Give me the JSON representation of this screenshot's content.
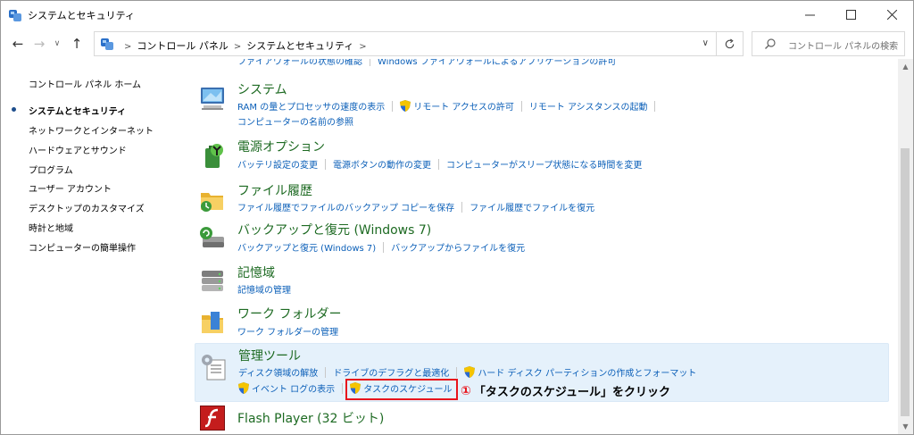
{
  "window": {
    "title": "システムとセキュリティ"
  },
  "address": {
    "crumbs": [
      "コントロール パネル",
      "システムとセキュリティ"
    ],
    "search_placeholder": "コントロール パネルの検索"
  },
  "leftnav": {
    "home": "コントロール パネル ホーム",
    "items": [
      {
        "label": "システムとセキュリティ",
        "selected": true
      },
      {
        "label": "ネットワークとインターネット"
      },
      {
        "label": "ハードウェアとサウンド"
      },
      {
        "label": "プログラム"
      },
      {
        "label": "ユーザー アカウント"
      },
      {
        "label": "デスクトップのカスタマイズ"
      },
      {
        "label": "時計と地域"
      },
      {
        "label": "コンピューターの簡単操作"
      }
    ]
  },
  "categories": {
    "firewall": {
      "links": [
        "ファイアウォールの状態の確認",
        "Windows ファイアウォールによるアプリケーションの許可"
      ]
    },
    "system": {
      "title": "システム",
      "links_row1": [
        "RAM の量とプロセッサの速度の表示",
        "リモート アクセスの許可",
        "リモート アシスタンスの起動"
      ],
      "links_row2": [
        "コンピューターの名前の参照"
      ]
    },
    "power": {
      "title": "電源オプション",
      "links": [
        "バッテリ設定の変更",
        "電源ボタンの動作の変更",
        "コンピューターがスリープ状態になる時間を変更"
      ]
    },
    "history": {
      "title": "ファイル履歴",
      "links": [
        "ファイル履歴でファイルのバックアップ コピーを保存",
        "ファイル履歴でファイルを復元"
      ]
    },
    "backup": {
      "title": "バックアップと復元 (Windows 7)",
      "links": [
        "バックアップと復元 (Windows 7)",
        "バックアップからファイルを復元"
      ]
    },
    "storage": {
      "title": "記憶域",
      "links": [
        "記憶域の管理"
      ]
    },
    "workfolders": {
      "title": "ワーク フォルダー",
      "links": [
        "ワーク フォルダーの管理"
      ]
    },
    "admin": {
      "title": "管理ツール",
      "links_row1": [
        "ディスク領域の解放",
        "ドライブのデフラグと最適化",
        "ハード ディスク パーティションの作成とフォーマット"
      ],
      "links_row2": [
        "イベント ログの表示",
        "タスクのスケジュール"
      ]
    },
    "flash": {
      "title": "Flash Player (32 ビット)"
    }
  },
  "annotation": {
    "number": "①",
    "text": "「タスクのスケジュール」をクリック",
    "color": "#e8141c"
  },
  "colors": {
    "link": "#0b5fb8",
    "category_title": "#1d6a22",
    "highlight_bg": "#e5f1fb"
  }
}
